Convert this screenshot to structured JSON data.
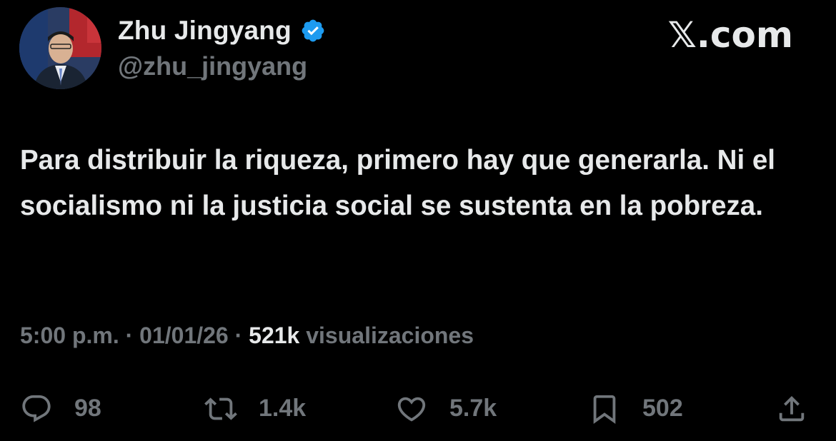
{
  "author": {
    "display_name": "Zhu Jingyang",
    "handle": "@zhu_jingyang",
    "verified_icon": "verified-badge-icon",
    "verified_color": "#1d9bf0"
  },
  "brand": "𝕏.com",
  "tweet": {
    "text": "Para distribuir la riqueza, primero hay que generarla. Ni el socialismo ni la justicia social se sustenta en la pobreza."
  },
  "meta": {
    "time": "5:00 p.m.",
    "separator": "·",
    "date": "01/01/26",
    "views_count": "521k",
    "views_label": "visualizaciones"
  },
  "actions": {
    "replies": {
      "icon": "reply-icon",
      "count": "98"
    },
    "reposts": {
      "icon": "repost-icon",
      "count": "1.4k"
    },
    "likes": {
      "icon": "heart-icon",
      "count": "5.7k"
    },
    "bookmarks": {
      "icon": "bookmark-icon",
      "count": "502"
    },
    "share": {
      "icon": "share-icon"
    }
  },
  "colors": {
    "background": "#000000",
    "text_primary": "#e7e9ea",
    "text_secondary": "#71767b"
  }
}
